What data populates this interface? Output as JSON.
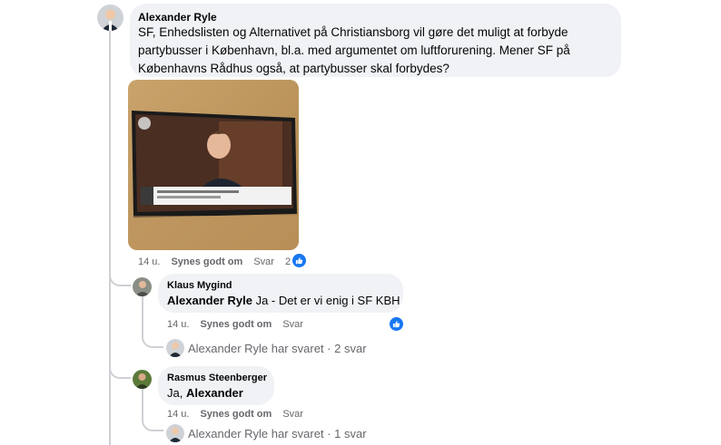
{
  "main_comment": {
    "author": "Alexander Ryle",
    "text": "SF, Enhedslisten og Alternativet på Christiansborg vil gøre det muligt at forbyde partybusser i København, bl.a. med argumentet om luftforurening. Mener SF på Københavns Rådhus også, at partybusser skal forbydes?",
    "age": "14 u.",
    "like_label": "Synes godt om",
    "reply_label": "Svar",
    "reaction_count": "2"
  },
  "replies": [
    {
      "author": "Klaus Mygind",
      "mention": "Alexander Ryle",
      "text": "Ja - Det er vi enig i SF KBH",
      "age": "14 u.",
      "like_label": "Synes godt om",
      "reply_label": "Svar",
      "thread_summary": "Alexander Ryle har svaret · 2 svar"
    },
    {
      "author": "Rasmus Steenberger",
      "text_prefix": "Ja,",
      "mention": "Alexander",
      "age": "14 u.",
      "like_label": "Synes godt om",
      "reply_label": "Svar",
      "thread_summary": "Alexander Ryle har svaret · 1 svar"
    }
  ],
  "colors": {
    "bubble": "#f0f2f5",
    "like_blue": "#1877f2",
    "meta_gray": "#65676b",
    "thread_line": "#ced0d4"
  }
}
